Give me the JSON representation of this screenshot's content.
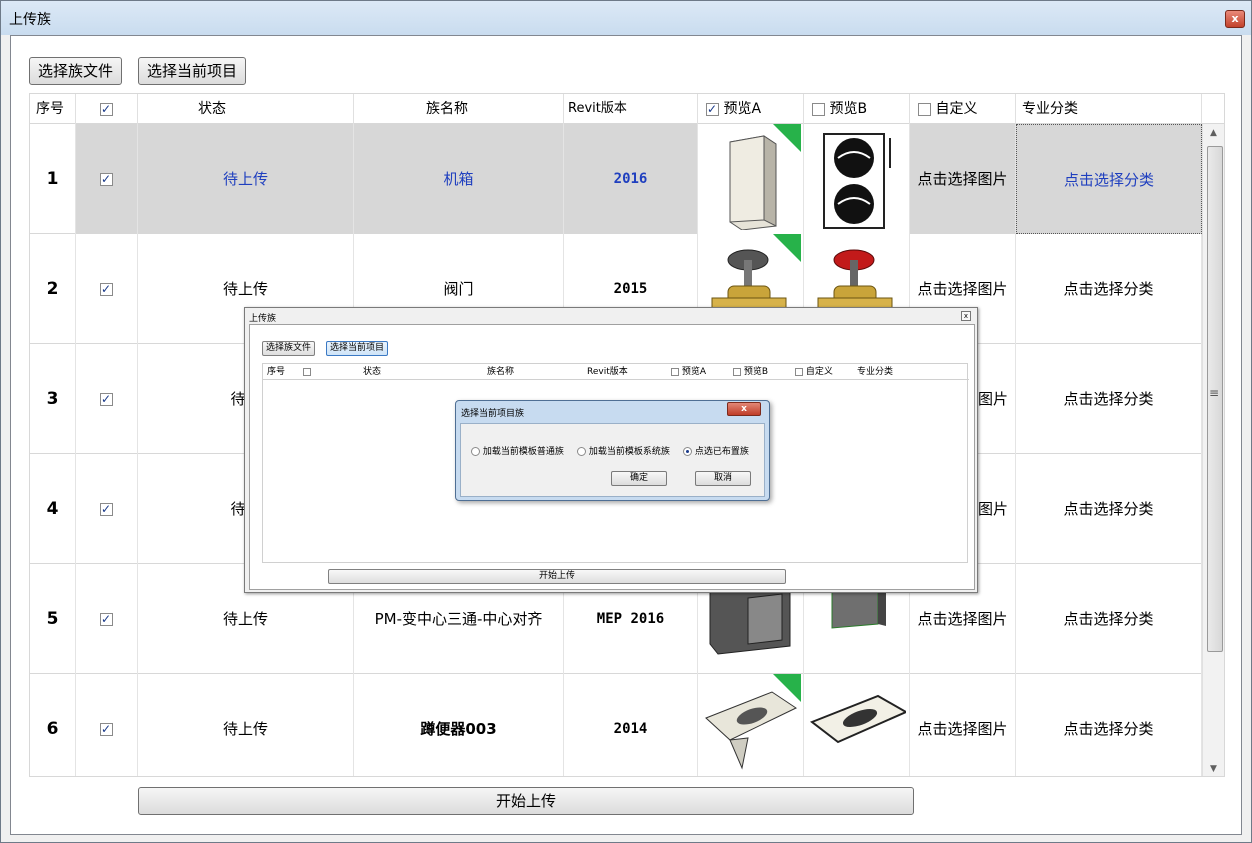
{
  "window": {
    "title": "上传族",
    "close": "x"
  },
  "toolbar": {
    "select_family_file": "选择族文件",
    "select_current_project": "选择当前项目"
  },
  "columns": {
    "seq": "序号",
    "status": "状态",
    "family_name": "族名称",
    "revit_version": "Revit版本",
    "preview_a": "预览A",
    "preview_b": "预览B",
    "custom": "自定义",
    "category": "专业分类"
  },
  "rows": [
    {
      "seq": "1",
      "status": "待上传",
      "family_name": "机箱",
      "version": "2016",
      "custom": "点击选择图片",
      "category": "点击选择分类",
      "selected": true
    },
    {
      "seq": "2",
      "status": "待上传",
      "family_name": "阀门",
      "version": "2015",
      "custom": "点击选择图片",
      "category": "点击选择分类"
    },
    {
      "seq": "3",
      "status": "待上",
      "family_name": "",
      "version": "",
      "custom": "图片",
      "category": "点击选择分类"
    },
    {
      "seq": "4",
      "status": "待上",
      "family_name": "",
      "version": "",
      "custom": "图片",
      "category": "点击选择分类"
    },
    {
      "seq": "5",
      "status": "待上传",
      "family_name": "PM-变中心三通-中心对齐",
      "version": "MEP 2016",
      "custom": "点击选择图片",
      "category": "点击选择分类"
    },
    {
      "seq": "6",
      "status": "待上传",
      "family_name": "蹲便器003",
      "version": "2014",
      "custom": "点击选择图片",
      "category": "点击选择分类"
    }
  ],
  "start_upload": "开始上传",
  "mini_window": {
    "title": "上传族",
    "close": "x",
    "select_family_file": "选择族文件",
    "select_current_project": "选择当前项目",
    "columns": {
      "seq": "序号",
      "status": "状态",
      "family_name": "族名称",
      "revit_version": "Revit版本",
      "preview_a": "预览A",
      "preview_b": "预览B",
      "custom": "自定义",
      "category": "专业分类"
    },
    "start_upload": "开始上传"
  },
  "dialog": {
    "title": "选择当前项目族",
    "close": "x",
    "option1": "加载当前模板普通族",
    "option2": "加载当前模板系统族",
    "option3": "点选已布置族",
    "ok": "确定",
    "cancel": "取消"
  },
  "colors": {
    "accent_text": "#1f3fbf",
    "selected_row": "#d7d7d7",
    "check_badge": "#27b24a"
  }
}
